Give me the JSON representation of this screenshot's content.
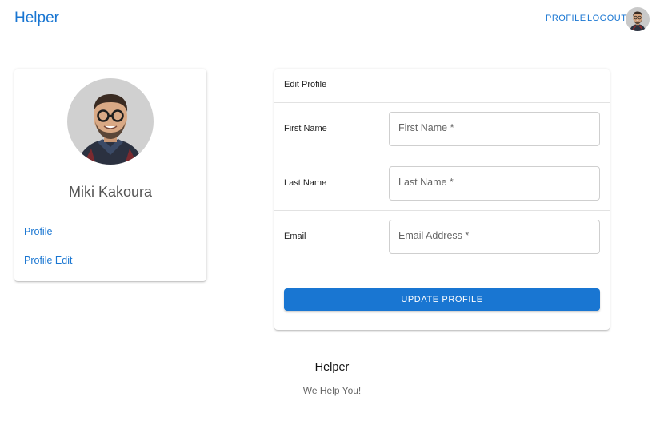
{
  "appbar": {
    "brand": "Helper",
    "nav_profile": "PROFILE",
    "nav_logout": "LOGOUT"
  },
  "user_card": {
    "name": "Miki Kakoura",
    "links": [
      "Profile",
      "Profile Edit"
    ]
  },
  "edit_form": {
    "header": "Edit Profile",
    "first_name_label": "First Name",
    "first_name_placeholder": "First Name *",
    "last_name_label": "Last Name",
    "last_name_placeholder": "Last Name *",
    "email_label": "Email",
    "email_placeholder": "Email Address *",
    "submit_label": "UPDATE PROFILE"
  },
  "footer": {
    "title": "Helper",
    "subtitle": "We Help You!"
  },
  "colors": {
    "primary": "#1976d2"
  },
  "icons": {
    "avatar": "user-avatar-photo"
  }
}
